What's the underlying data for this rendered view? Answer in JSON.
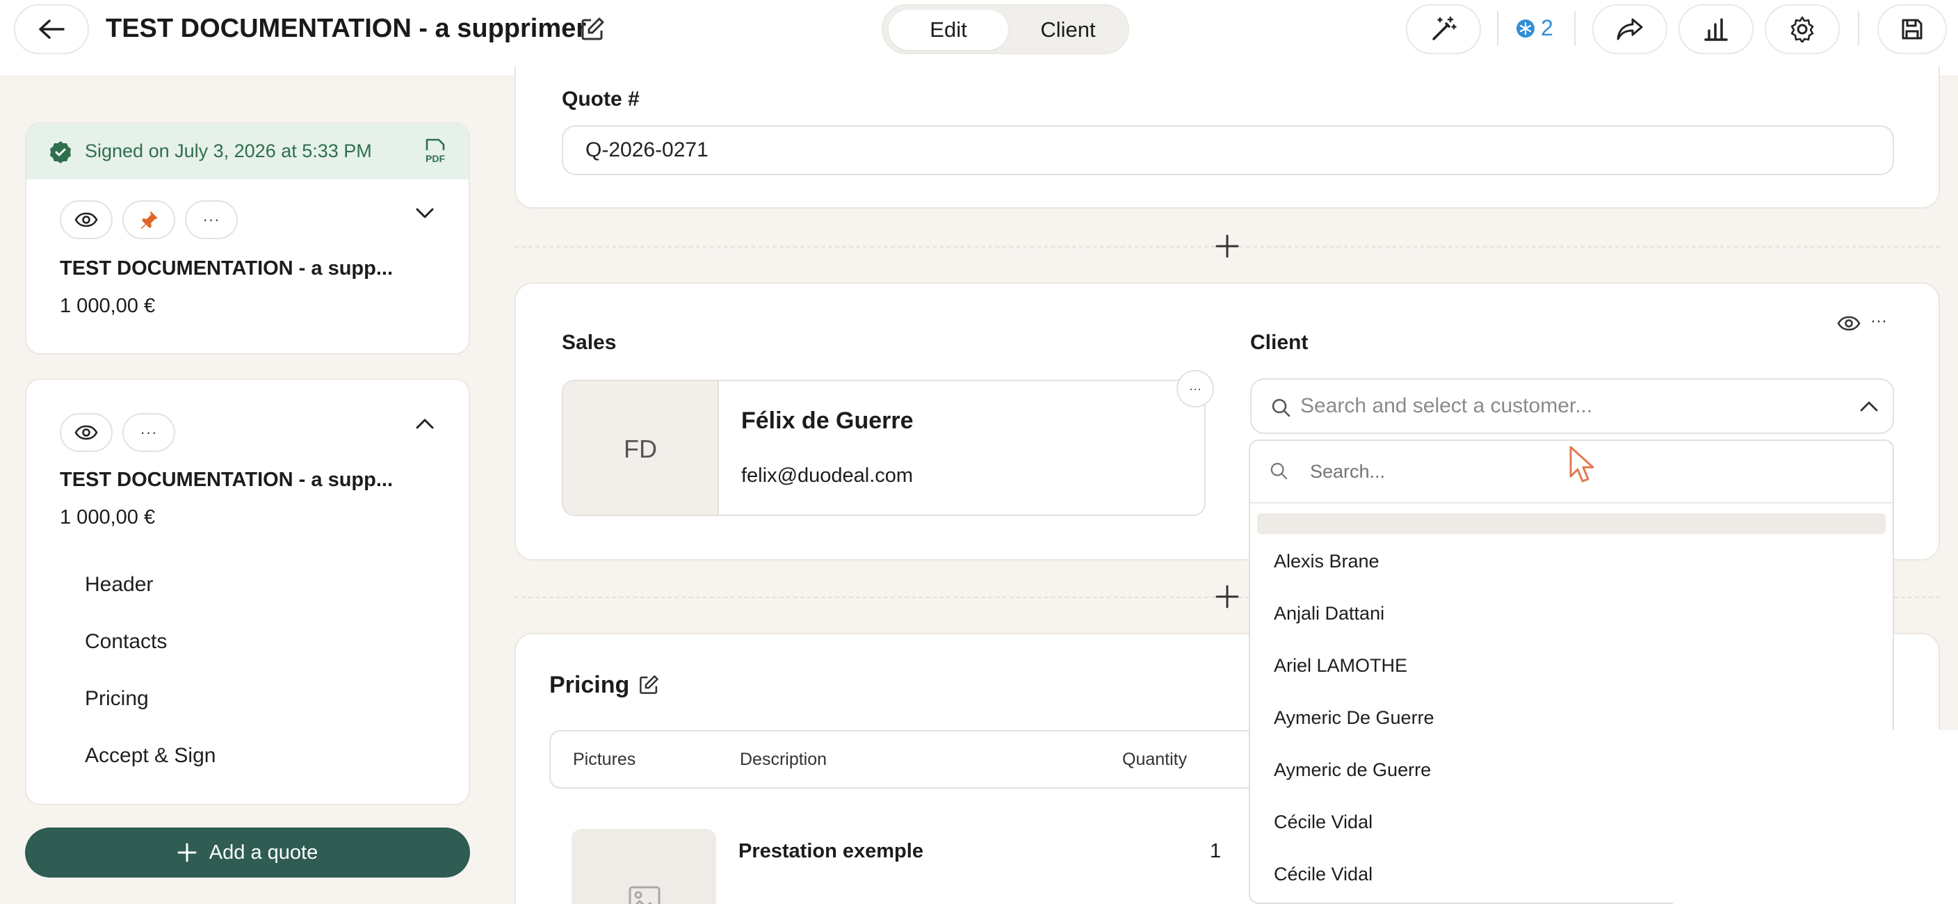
{
  "header": {
    "title": "TEST DOCUMENTATION - a supprimer",
    "tabs": [
      "Edit",
      "Client"
    ],
    "badge_count": "2",
    "icons": [
      "back-arrow-icon",
      "edit-icon",
      "magic-wand-icon",
      "snowflake-icon",
      "share-icon",
      "chart-icon",
      "gear-icon",
      "save-icon"
    ]
  },
  "sidebar": {
    "signed_text": "Signed on July 3, 2026 at 5:33 PM",
    "pdf_label": "PDF",
    "card1": {
      "title": "TEST DOCUMENTATION - a supp...",
      "amount": "1 000,00 €"
    },
    "card2": {
      "title": "TEST DOCUMENTATION - a supp...",
      "amount": "1 000,00 €"
    },
    "nav": [
      "Header",
      "Contacts",
      "Pricing",
      "Accept & Sign"
    ],
    "add_quote": "Add a quote",
    "more_glyph": "···"
  },
  "quote": {
    "label": "Quote #",
    "value": "Q-2026-0271"
  },
  "sales": {
    "label": "Sales",
    "initials": "FD",
    "name": "Félix de Guerre",
    "email": "felix@duodeal.com"
  },
  "client": {
    "label": "Client",
    "placeholder": "Search and select a customer...",
    "search_placeholder": "Search...",
    "options": [
      "Alexis Brane",
      "Anjali Dattani",
      "Ariel LAMOTHE",
      "Aymeric De Guerre",
      "Aymeric de Guerre",
      "Cécile Vidal",
      "Cécile Vidal"
    ]
  },
  "pricing": {
    "title": "Pricing",
    "columns": [
      "Pictures",
      "Description",
      "Quantity"
    ],
    "row": {
      "description": "Prestation exemple",
      "quantity": "1"
    }
  },
  "colors": {
    "accent_green": "#2f5c53",
    "signed_bg": "#e6f1ea",
    "signed_text": "#2f6f4d",
    "pin_orange": "#e0652a",
    "snow_blue": "#2f8fd6"
  }
}
